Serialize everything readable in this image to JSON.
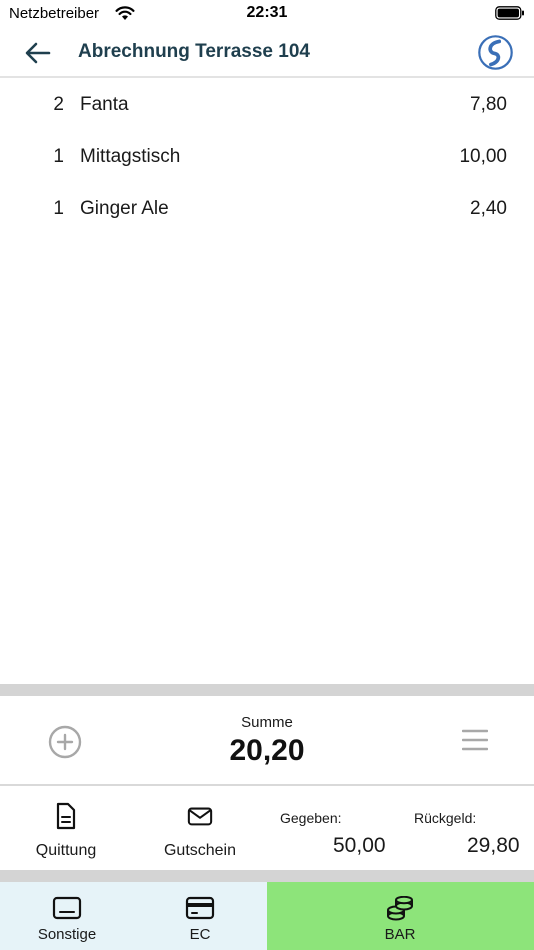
{
  "status_bar": {
    "carrier": "Netzbetreiber",
    "time": "22:31"
  },
  "header": {
    "title": "Abrechnung Terrasse 104",
    "logo_icon": "brand-swirl-icon"
  },
  "colors": {
    "title": "#1f3f4e",
    "logo_blue": "#3a6fb7",
    "bar_active": "#8de47a",
    "tab_inactive": "#e6f3f8",
    "separator": "#d4d4d4"
  },
  "order_items": [
    {
      "qty": "2",
      "name": "Fanta",
      "price": "7,80"
    },
    {
      "qty": "1",
      "name": "Mittagstisch",
      "price": "10,00"
    },
    {
      "qty": "1",
      "name": "Ginger Ale",
      "price": "2,40"
    }
  ],
  "summary": {
    "label": "Summe",
    "value": "20,20"
  },
  "actions": {
    "receipt_label": "Quittung",
    "voucher_label": "Gutschein",
    "given_label": "Gegeben:",
    "given_value": "50,00",
    "change_label": "Rückgeld:",
    "change_value": "29,80"
  },
  "payment_tabs": [
    {
      "label": "Sonstige",
      "icon": "display-icon"
    },
    {
      "label": "EC",
      "icon": "credit-card-icon"
    },
    {
      "label": "BAR",
      "icon": "coins-icon"
    }
  ]
}
